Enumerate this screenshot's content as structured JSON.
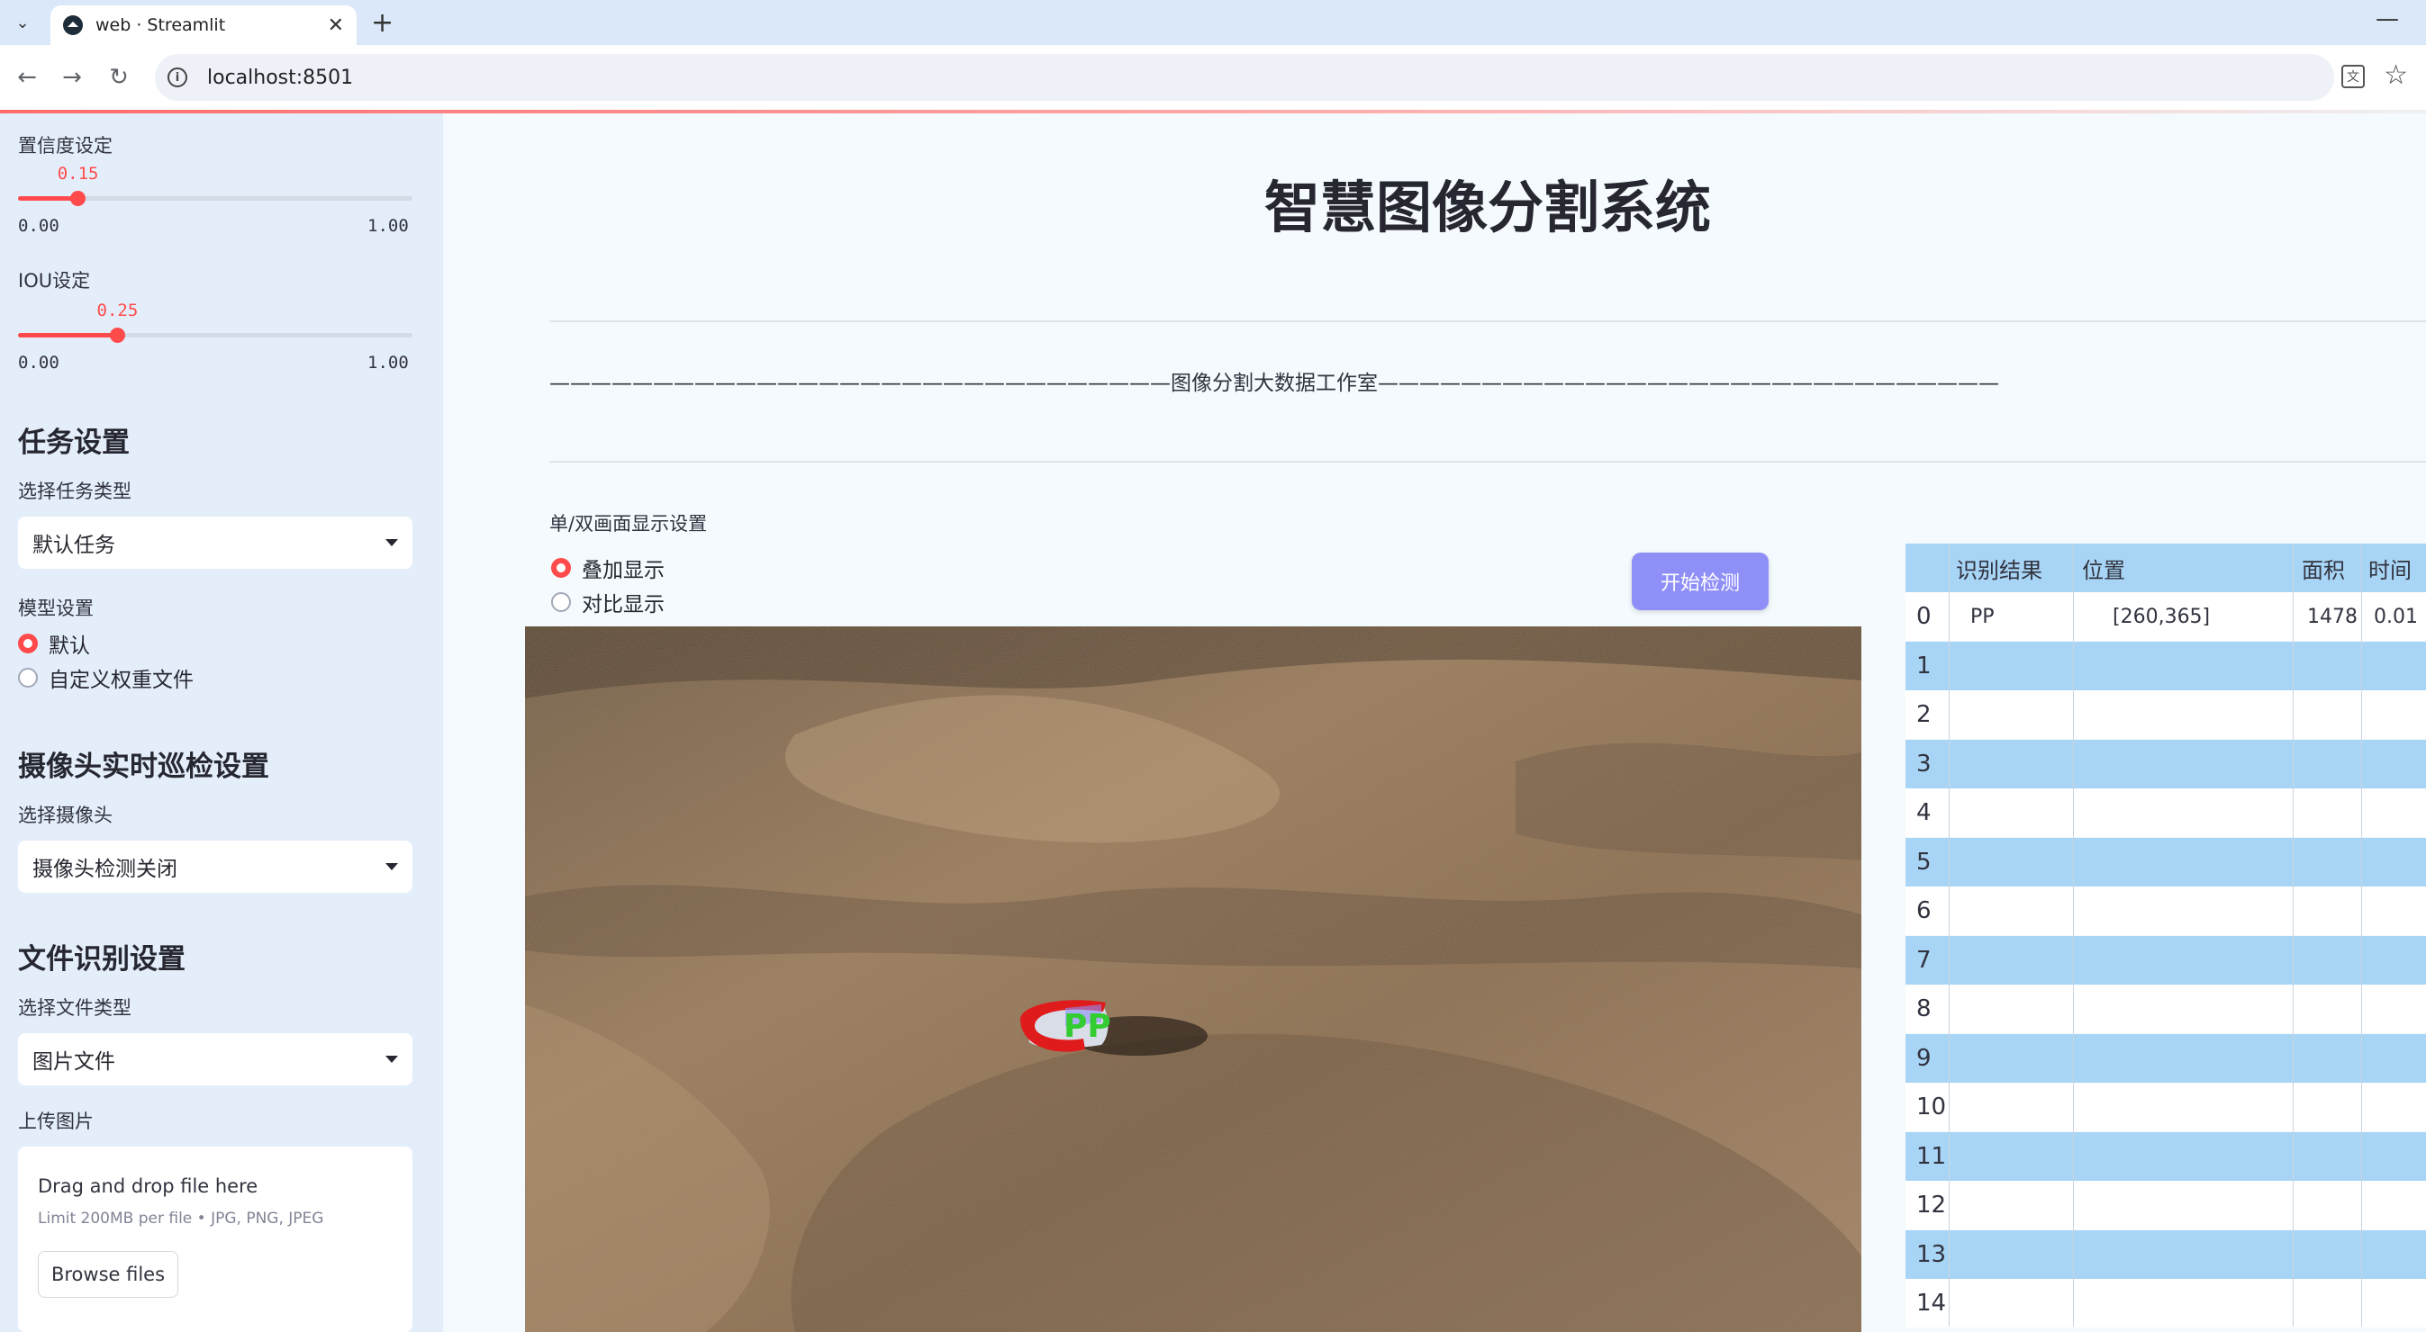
{
  "browser": {
    "tab_title": "web · Streamlit",
    "url": "localhost:8501"
  },
  "sidebar": {
    "confidence": {
      "label": "置信度设定",
      "value": "0.15",
      "fraction": 0.15,
      "min": "0.00",
      "max": "1.00"
    },
    "iou": {
      "label": "IOU设定",
      "value": "0.25",
      "fraction": 0.25,
      "min": "0.00",
      "max": "1.00"
    },
    "task": {
      "heading": "任务设置",
      "label": "选择任务类型",
      "selected": "默认任务"
    },
    "model": {
      "label": "模型设置",
      "options": [
        "默认",
        "自定义权重文件"
      ],
      "selected_index": 0
    },
    "camera": {
      "heading": "摄像头实时巡检设置",
      "label": "选择摄像头",
      "selected": "摄像头检测关闭"
    },
    "file": {
      "heading": "文件识别设置",
      "label": "选择文件类型",
      "selected": "图片文件"
    },
    "upload": {
      "label": "上传图片",
      "title": "Drag and drop file here",
      "limit": "Limit 200MB per file • JPG, PNG, JPEG",
      "button": "Browse files"
    }
  },
  "main": {
    "title": "智慧图像分割系统",
    "banner": "——————————————————————————————图像分割大数据工作室——————————————————————————————",
    "display_label": "单/双画面显示设置",
    "display_options": [
      "叠加显示",
      "对比显示"
    ],
    "display_selected_index": 0,
    "detect_button": "开始检测",
    "detection_label": "PP"
  },
  "table": {
    "columns": [
      "识别结果",
      "位置",
      "面积",
      "时间"
    ],
    "rows": [
      {
        "index": "0",
        "result": "PP",
        "position": "[260,365]",
        "area": "1478",
        "time": "0.01"
      },
      {
        "index": "1"
      },
      {
        "index": "2"
      },
      {
        "index": "3"
      },
      {
        "index": "4"
      },
      {
        "index": "5"
      },
      {
        "index": "6"
      },
      {
        "index": "7"
      },
      {
        "index": "8"
      },
      {
        "index": "9"
      },
      {
        "index": "10"
      },
      {
        "index": "11"
      },
      {
        "index": "12"
      },
      {
        "index": "13"
      },
      {
        "index": "14"
      }
    ]
  },
  "colors": {
    "accent": "#ff4b4b",
    "sidebar_bg": "#e4eefb",
    "button": "#8f8ff8",
    "table_stripe": "#a8d4f5"
  }
}
